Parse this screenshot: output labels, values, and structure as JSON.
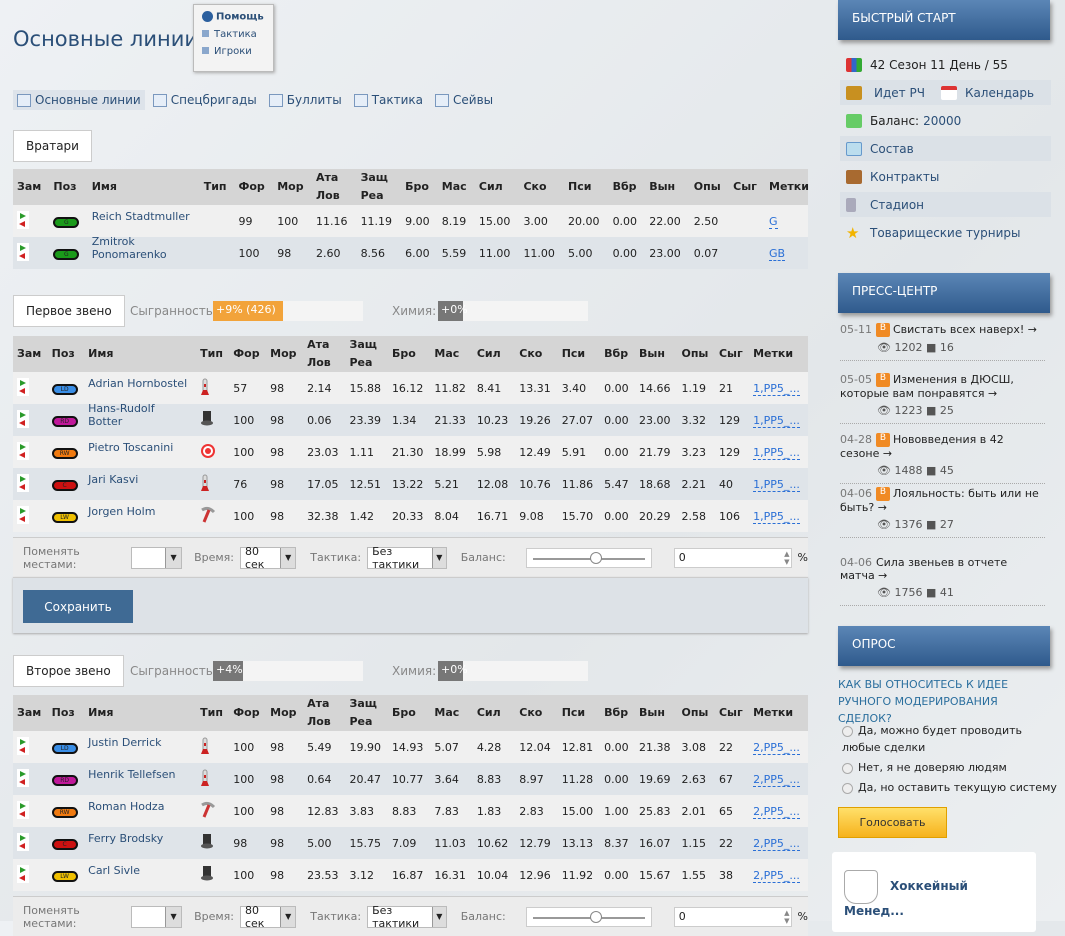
{
  "page": {
    "title": "Основные линии"
  },
  "help": {
    "title": "Помощь",
    "links": [
      "Тактика",
      "Игроки"
    ]
  },
  "tabs": [
    {
      "label": "Основные линии",
      "icon": "lines-icon"
    },
    {
      "label": "Спецбригады",
      "icon": "special-icon"
    },
    {
      "label": "Буллиты",
      "icon": "shield-icon"
    },
    {
      "label": "Тактика",
      "icon": "tactics-icon"
    },
    {
      "label": "Сейвы",
      "icon": "saves-icon"
    }
  ],
  "columns": [
    "Зам",
    "Поз",
    "Имя",
    "Тип",
    "Фор",
    "Мор",
    "Ата Лов",
    "Защ Реа",
    "Бро",
    "Мас",
    "Сил",
    "Ско",
    "Пси",
    "Вбр",
    "Вын",
    "Опы",
    "Сыг",
    "Метки"
  ],
  "goalies": {
    "label": "Вратари",
    "rows": [
      {
        "pos": "G",
        "name": "Reich Stadtmuller",
        "type": "",
        "vals": [
          "99",
          "100",
          "11.16",
          "11.19",
          "9.00",
          "8.19",
          "15.00",
          "3.00",
          "20.00",
          "0.00",
          "22.00",
          "2.50",
          ""
        ],
        "mark": "G"
      },
      {
        "pos": "G",
        "name": "Zmitrok Ponomarenko",
        "type": "",
        "vals": [
          "100",
          "98",
          "2.60",
          "8.56",
          "6.00",
          "5.59",
          "11.00",
          "11.00",
          "5.00",
          "0.00",
          "23.00",
          "0.07",
          ""
        ],
        "mark": "GB"
      }
    ]
  },
  "line1": {
    "label": "Первое звено",
    "chem_label": "Сыгранность:",
    "chem_value": "+9% (426)",
    "chem_pct": 9,
    "chemistry_label": "Химия:",
    "chemistry_value": "+0%",
    "rows": [
      {
        "pos": "LD",
        "name": "Adrian Hornbostel",
        "type": "rocket",
        "vals": [
          "57",
          "98",
          "2.14",
          "15.88",
          "16.12",
          "11.82",
          "8.41",
          "13.31",
          "3.40",
          "0.00",
          "14.66",
          "1.19",
          "21"
        ],
        "mark": "1,PP5_..."
      },
      {
        "pos": "RD",
        "name": "Hans-Rudolf Botter",
        "type": "top-hat",
        "vals": [
          "100",
          "98",
          "0.06",
          "23.39",
          "1.34",
          "21.33",
          "10.23",
          "19.26",
          "27.07",
          "0.00",
          "23.00",
          "3.32",
          "129"
        ],
        "mark": "1,PP5_..."
      },
      {
        "pos": "RW",
        "name": "Pietro Toscanini",
        "type": "target",
        "vals": [
          "100",
          "98",
          "23.03",
          "1.11",
          "21.30",
          "18.99",
          "5.98",
          "12.49",
          "5.91",
          "0.00",
          "21.79",
          "3.23",
          "129"
        ],
        "mark": "1,PP5_..."
      },
      {
        "pos": "C",
        "name": "Jari Kasvi",
        "type": "rocket",
        "vals": [
          "76",
          "98",
          "17.05",
          "12.51",
          "13.22",
          "5.21",
          "12.08",
          "10.76",
          "11.86",
          "5.47",
          "18.68",
          "2.21",
          "40"
        ],
        "mark": "1,PP5_..."
      },
      {
        "pos": "LW",
        "name": "Jorgen Holm",
        "type": "pickaxe",
        "vals": [
          "100",
          "98",
          "32.38",
          "1.42",
          "20.33",
          "8.04",
          "16.71",
          "9.08",
          "15.70",
          "0.00",
          "20.29",
          "2.58",
          "106"
        ],
        "mark": "1,PP5_..."
      }
    ]
  },
  "line2": {
    "label": "Второе звено",
    "chem_label": "Сыгранность:",
    "chem_value": "+4%",
    "chem_pct": 4,
    "chemistry_label": "Химия:",
    "chemistry_value": "+0%",
    "rows": [
      {
        "pos": "LD",
        "name": "Justin Derrick",
        "type": "rocket",
        "vals": [
          "100",
          "98",
          "5.49",
          "19.90",
          "14.93",
          "5.07",
          "4.28",
          "12.04",
          "12.81",
          "0.00",
          "21.38",
          "3.08",
          "22"
        ],
        "mark": "2,PP5_..."
      },
      {
        "pos": "RD",
        "name": "Henrik Tellefsen",
        "type": "rocket",
        "vals": [
          "100",
          "98",
          "0.64",
          "20.47",
          "10.77",
          "3.64",
          "8.83",
          "8.97",
          "11.28",
          "0.00",
          "19.69",
          "2.63",
          "67"
        ],
        "mark": "2,PP5_..."
      },
      {
        "pos": "RW",
        "name": "Roman Hodza",
        "type": "pickaxe",
        "vals": [
          "100",
          "98",
          "12.83",
          "3.83",
          "8.83",
          "7.83",
          "1.83",
          "2.83",
          "15.00",
          "1.00",
          "25.83",
          "2.01",
          "65"
        ],
        "mark": "2,PP5_..."
      },
      {
        "pos": "C",
        "name": "Ferry Brodsky",
        "type": "top-hat",
        "vals": [
          "98",
          "98",
          "5.00",
          "15.75",
          "7.09",
          "11.03",
          "10.62",
          "12.79",
          "13.13",
          "8.37",
          "16.07",
          "1.15",
          "22"
        ],
        "mark": "2,PP5_..."
      },
      {
        "pos": "LW",
        "name": "Carl Sivle",
        "type": "top-hat",
        "vals": [
          "100",
          "98",
          "23.53",
          "3.12",
          "16.87",
          "16.31",
          "10.04",
          "12.96",
          "11.92",
          "0.00",
          "15.67",
          "1.55",
          "38"
        ],
        "mark": "2,PP5_..."
      }
    ]
  },
  "controls": {
    "swap_label": "Поменять местами:",
    "swap_value": "",
    "time_label": "Время:",
    "time_value": "80 сек",
    "tactic_label": "Тактика:",
    "tactic_value": "Без тактики",
    "balance_label": "Баланс:",
    "balance_value": "0",
    "balance_unit": "%",
    "save": "Сохранить"
  },
  "pos_colors": {
    "G": "#1a9a1a",
    "LD": "#3a8ee6",
    "RD": "#c0189a",
    "RW": "#f07a10",
    "C": "#cc1111",
    "LW": "#f0c000"
  },
  "sidebar": {
    "quick_title": "БЫСТРЫЙ СТАРТ",
    "season": "42 Сезон 11 День / 55",
    "championship": "Идет РЧ",
    "calendar": "Календарь",
    "balance_label": "Баланс:",
    "balance_value": "20000",
    "links": [
      "Состав",
      "Контракты",
      "Стадион",
      "Товарищеские турниры"
    ],
    "press_title": "ПРЕСС-ЦЕНТР",
    "news": [
      {
        "date": "05-11",
        "title": "Свистать всех наверх! →",
        "views": "1202",
        "comments": "16",
        "blog": true
      },
      {
        "date": "05-05",
        "title": "Изменения в ДЮСШ, которые вам понравятся →",
        "views": "1223",
        "comments": "25",
        "blog": true
      },
      {
        "date": "04-28",
        "title": "Нововведения в 42 сезоне →",
        "views": "1488",
        "comments": "45",
        "blog": true
      },
      {
        "date": "04-06",
        "title": "Лояльность: быть или не быть? →",
        "views": "1376",
        "comments": "27",
        "blog": true
      },
      {
        "date": "04-06",
        "title": "Сила звеньев в отчете матча →",
        "views": "1756",
        "comments": "41",
        "blog": false
      }
    ],
    "poll_title": "ОПРОС",
    "poll_question": "КАК ВЫ ОТНОСИТЕСЬ К ИДЕЕ РУЧНОГО МОДЕРИРОВАНИЯ СДЕЛОК?",
    "poll_options": [
      "Да, можно будет проводить любые сделки",
      "Нет, я не доверяю людям",
      "Да, но оставить текущую систему"
    ],
    "vote": "Голосовать",
    "card_title": "Хоккейный Менед..."
  }
}
